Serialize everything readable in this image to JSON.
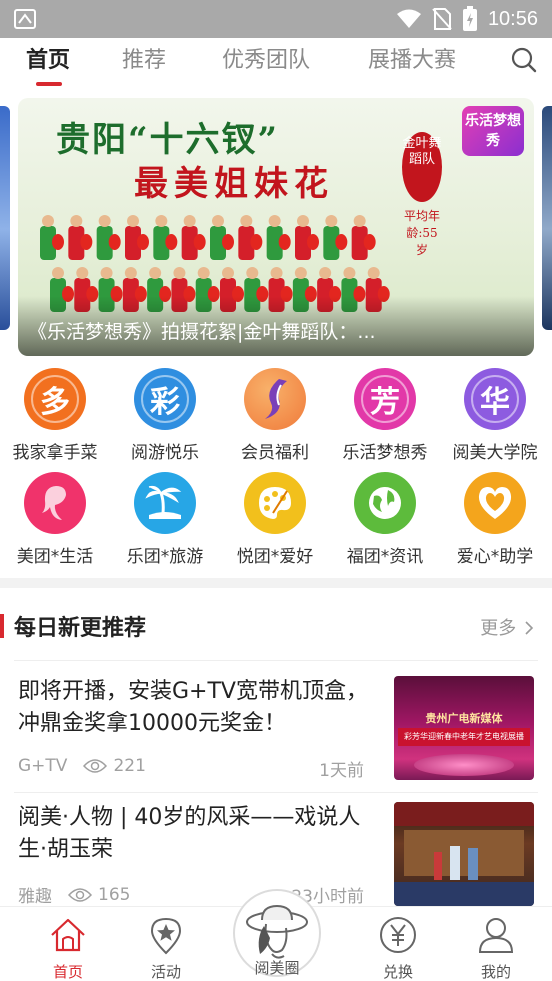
{
  "status_bar": {
    "time": "10:56",
    "icons": [
      "app-notification-icon",
      "wifi-icon",
      "no-sim-icon",
      "battery-charging-icon"
    ]
  },
  "top_nav": {
    "tabs": [
      {
        "label": "首页",
        "active": true
      },
      {
        "label": "推荐",
        "active": false
      },
      {
        "label": "优秀团队",
        "active": false
      },
      {
        "label": "展播大赛",
        "active": false
      }
    ],
    "search_icon": "search-icon"
  },
  "banner": {
    "title_line1": "贵阳“十六钗”",
    "title_line2": "最美姐妹花",
    "side_text": "金叶舞蹈队",
    "side_note": "平均年龄:55岁",
    "logo_text": "乐活梦想秀",
    "caption": "《乐活梦想秀》拍摄花絮|金叶舞蹈队：..."
  },
  "grid": {
    "items": [
      {
        "label": "我家拿手菜",
        "glyph": "多",
        "color": "#f2701f",
        "icon": "cooking-icon"
      },
      {
        "label": "阅游悦乐",
        "glyph": "彩",
        "color": "#2f8ee0",
        "icon": "color-icon"
      },
      {
        "label": "会员福利",
        "glyph": "",
        "color": "#f07a3a",
        "icon": "member-benefit-icon"
      },
      {
        "label": "乐活梦想秀",
        "glyph": "芳",
        "color": "#e238a8",
        "icon": "dream-show-icon"
      },
      {
        "label": "阅美大学院",
        "glyph": "华",
        "color": "#8d5be0",
        "icon": "academy-icon"
      },
      {
        "label": "美团*生活",
        "glyph": "",
        "color": "#f0336b",
        "icon": "lifestyle-icon"
      },
      {
        "label": "乐团*旅游",
        "glyph": "",
        "color": "#27a6e6",
        "icon": "palm-tree-icon"
      },
      {
        "label": "悦团*爱好",
        "glyph": "",
        "color": "#f2c01c",
        "icon": "palette-icon"
      },
      {
        "label": "福团*资讯",
        "glyph": "",
        "color": "#5dbb3c",
        "icon": "globe-icon"
      },
      {
        "label": "爱心*助学",
        "glyph": "",
        "color": "#f4a51c",
        "icon": "heart-icon"
      }
    ]
  },
  "section": {
    "title": "每日新更推荐",
    "more_label": "更多"
  },
  "articles": [
    {
      "title": "即将开播，安装G+TV宽带机顶盒，冲鼎金奖拿10000元奖金！",
      "source": "G+TV",
      "views": "221",
      "time": "1天前",
      "thumb_title": "贵州广电新媒体",
      "thumb_sub": "彩芳华迎新春中老年才艺电视展播"
    },
    {
      "title": "阅美·人物 | 40岁的风采——戏说人生·胡玉荣",
      "source": "雅趣",
      "views": "165",
      "time": "23小时前"
    }
  ],
  "bottom_nav": {
    "items": [
      {
        "label": "首页",
        "active": true,
        "icon": "home-icon"
      },
      {
        "label": "活动",
        "active": false,
        "icon": "activity-star-icon"
      },
      {
        "label": "阅美圈",
        "active": false,
        "icon": "lady-avatar-icon"
      },
      {
        "label": "兑换",
        "active": false,
        "icon": "yuan-exchange-icon"
      },
      {
        "label": "我的",
        "active": false,
        "icon": "profile-icon"
      }
    ]
  },
  "colors": {
    "accent": "#d8292f",
    "status_bar": "#a9a9a9",
    "muted_text": "#a0a0a0"
  }
}
